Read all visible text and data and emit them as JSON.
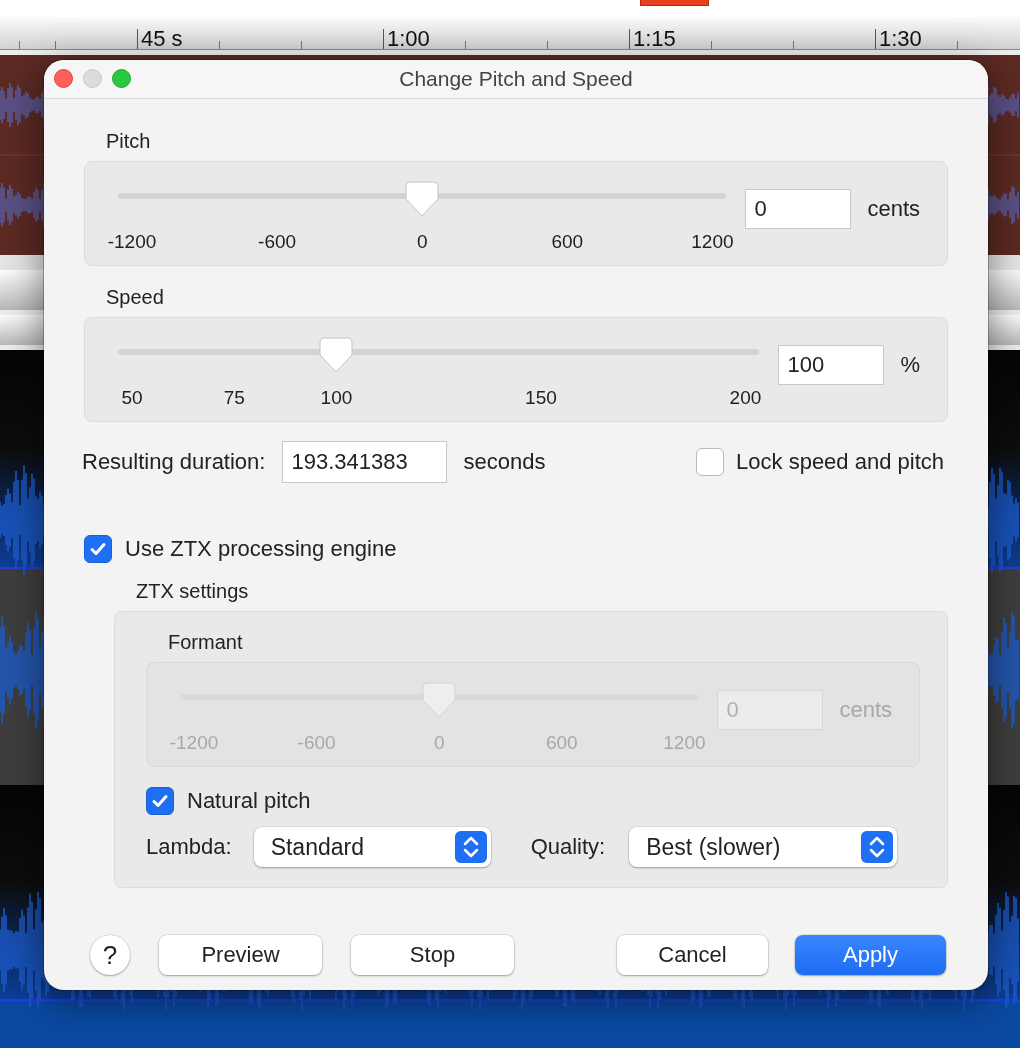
{
  "window": {
    "title": "Change Pitch and Speed"
  },
  "timeline": {
    "labels": [
      "45 s",
      "1:00",
      "1:15",
      "1:30"
    ]
  },
  "pitch": {
    "label": "Pitch",
    "level": 0.5,
    "ticks": [
      "-1200",
      "-600",
      "0",
      "600",
      "1200"
    ],
    "value": "0",
    "unit": "cents",
    "disabled": false
  },
  "speed": {
    "label": "Speed",
    "level": 0.333,
    "ticks": [
      "50",
      "75",
      "100",
      "150",
      "200"
    ],
    "value": "100",
    "unit": "%",
    "disabled": false
  },
  "duration": {
    "label": "Resulting duration:",
    "value": "193.341383",
    "unit": "seconds"
  },
  "lock": {
    "label": "Lock speed and pitch",
    "checked": false
  },
  "use_ztx": {
    "label": "Use ZTX processing engine",
    "checked": true
  },
  "ztx_settings": {
    "title": "ZTX settings",
    "formant": {
      "label": "Formant",
      "level": 0.5,
      "ticks": [
        "-1200",
        "-600",
        "0",
        "600",
        "1200"
      ],
      "value": "0",
      "unit": "cents",
      "disabled": true
    },
    "natural_pitch": {
      "label": "Natural pitch",
      "checked": true
    },
    "lambda": {
      "label": "Lambda:",
      "value": "Standard"
    },
    "quality": {
      "label": "Quality:",
      "value": "Best (slower)"
    }
  },
  "buttons": [
    {
      "kind": "help",
      "label": "?"
    },
    {
      "kind": "action",
      "label": "Preview"
    },
    {
      "kind": "action",
      "label": "Stop"
    },
    {
      "kind": "cancel",
      "label": "Cancel"
    },
    {
      "kind": "default",
      "label": "Apply"
    }
  ]
}
